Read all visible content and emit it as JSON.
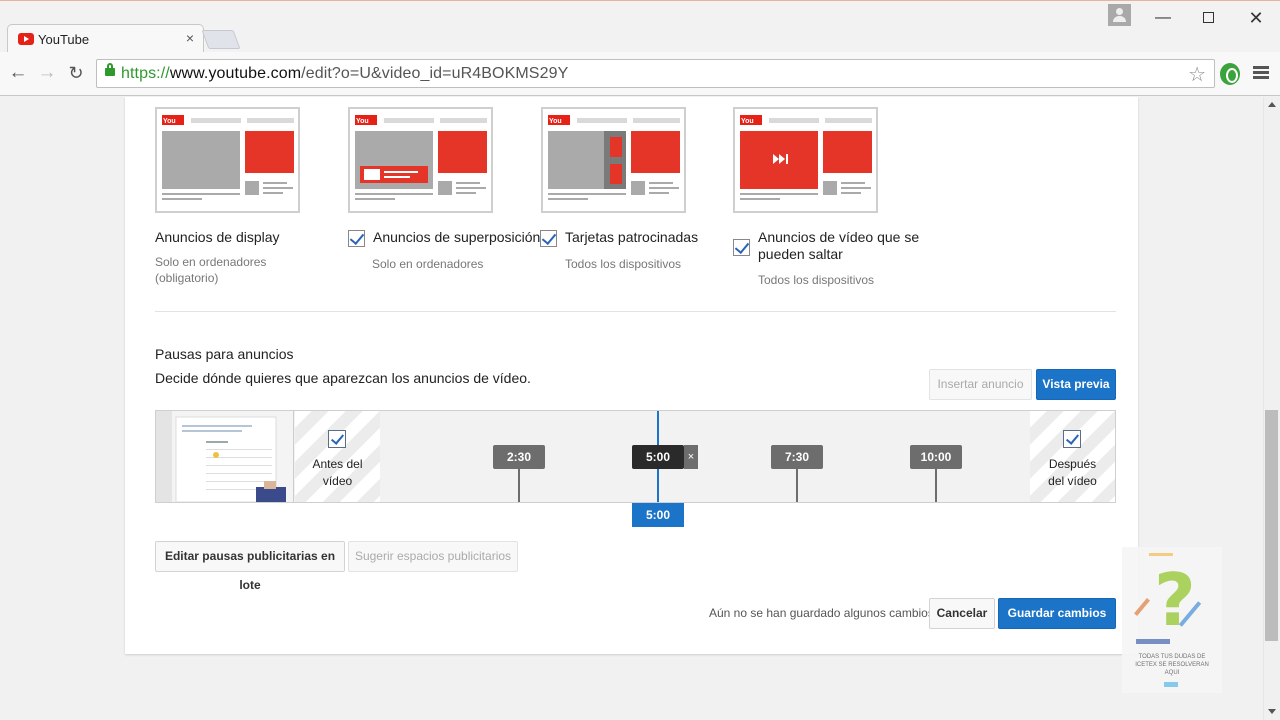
{
  "browser": {
    "tab_title": "YouTube",
    "tab_close": "×",
    "url_scheme": "https://",
    "url_host": "www.youtube.com",
    "url_path": "/edit?o=U&video_id=uR4BOKMS29Y",
    "window_controls": {
      "minimize": "—",
      "close": "✕"
    }
  },
  "ad_formats": [
    {
      "label": "Anuncios de display",
      "sub": "Solo en ordenadores\n(obligatorio)",
      "checked": false
    },
    {
      "label": "Anuncios de superposición",
      "sub": "Solo en ordenadores",
      "checked": true
    },
    {
      "label": "Tarjetas patrocinadas",
      "sub": "Todos los dispositivos",
      "checked": true
    },
    {
      "label": "Anuncios de vídeo que se pueden saltar",
      "label_line1": "Anuncios de vídeo que se",
      "label_line2": "pueden saltar",
      "sub": "Todos los dispositivos",
      "checked": true
    }
  ],
  "ad_breaks": {
    "title": "Pausas para anuncios",
    "description": "Decide dónde quieres que aparezcan los anuncios de vídeo.",
    "insert_button": "Insertar anuncio",
    "preview_button": "Vista previa",
    "before_label_1": "Antes del",
    "before_label_2": "vídeo",
    "after_label_1": "Después",
    "after_label_2": "del vídeo",
    "markers": [
      "2:30",
      "5:00",
      "7:30",
      "10:00"
    ],
    "active_marker": "5:00",
    "marker_remove": "×",
    "playhead_time": "5:00",
    "bulk_edit_button": "Editar pausas publicitarias en lote",
    "suggest_button": "Sugerir espacios publicitarios"
  },
  "footer": {
    "status": "Aún no se han guardado algunos cambios.",
    "cancel_button": "Cancelar",
    "save_button": "Guardar cambios"
  },
  "promo": {
    "text": "TODAS TUS DUDAS DE ICETEX SE RESOLVERAN AQUI"
  },
  "colors": {
    "accent_blue": "#1c74c8",
    "youtube_red": "#e62117",
    "marker_gray": "#6d6d6d"
  }
}
